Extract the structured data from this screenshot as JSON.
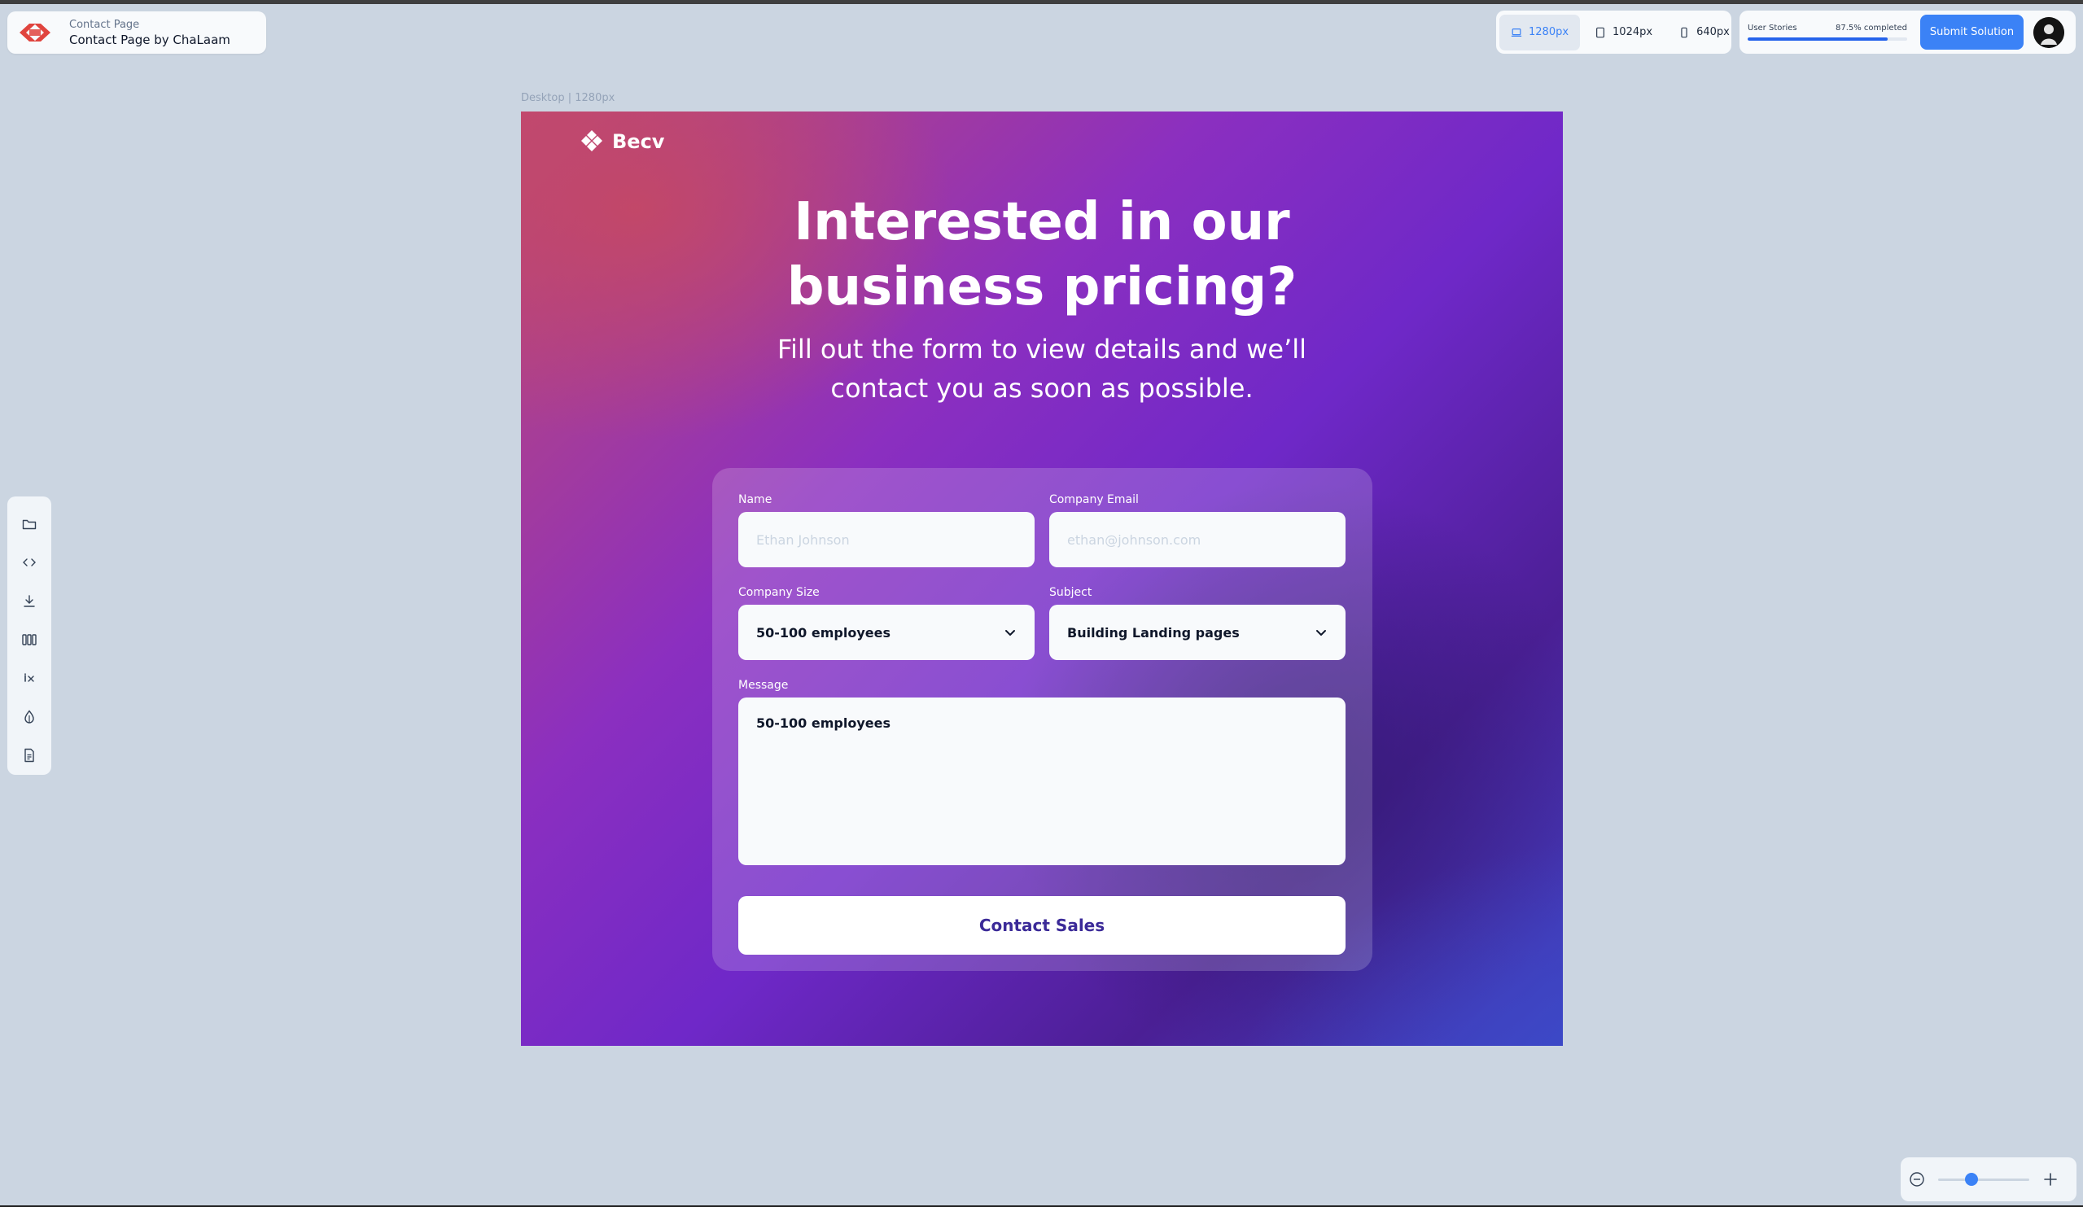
{
  "project": {
    "subtitle": "Contact Page",
    "title": "Contact Page by ChaLaam"
  },
  "viewport": {
    "options": [
      {
        "label": "1280px",
        "icon": "laptop-icon",
        "active": true
      },
      {
        "label": "1024px",
        "icon": "tablet-icon",
        "active": false
      },
      {
        "label": "640px",
        "icon": "phone-icon",
        "active": false
      }
    ]
  },
  "progress": {
    "label": "User Stories",
    "status": "87.5% completed",
    "value": 0.875
  },
  "submit": {
    "label": "Submit Solution"
  },
  "toolbar": {
    "tools": [
      "folder-icon",
      "code-icon",
      "download-icon",
      "columns-icon",
      "variable-icon",
      "color-drop-icon",
      "document-icon"
    ]
  },
  "canvas": {
    "label": "Desktop | 1280px"
  },
  "page": {
    "brand": "Becv",
    "headline_line1": "Interested in our",
    "headline_line2": "business pricing?",
    "subhead_line1": "Fill out the form to view details and we’ll",
    "subhead_line2": "contact you as soon as possible.",
    "form": {
      "name_label": "Name",
      "name_placeholder": "Ethan Johnson",
      "email_label": "Company Email",
      "email_placeholder": "ethan@johnson.com",
      "size_label": "Company Size",
      "size_value": "50-100 employees",
      "subject_label": "Subject",
      "subject_value": "Building Landing pages",
      "message_label": "Message",
      "message_value": "50-100 employees",
      "cta": "Contact Sales"
    }
  },
  "zoom": {
    "level": 0.37
  },
  "colors": {
    "accent": "#3b82f6",
    "cta_text": "#3b2a98",
    "canvas_bg": "#cbd5e1"
  }
}
